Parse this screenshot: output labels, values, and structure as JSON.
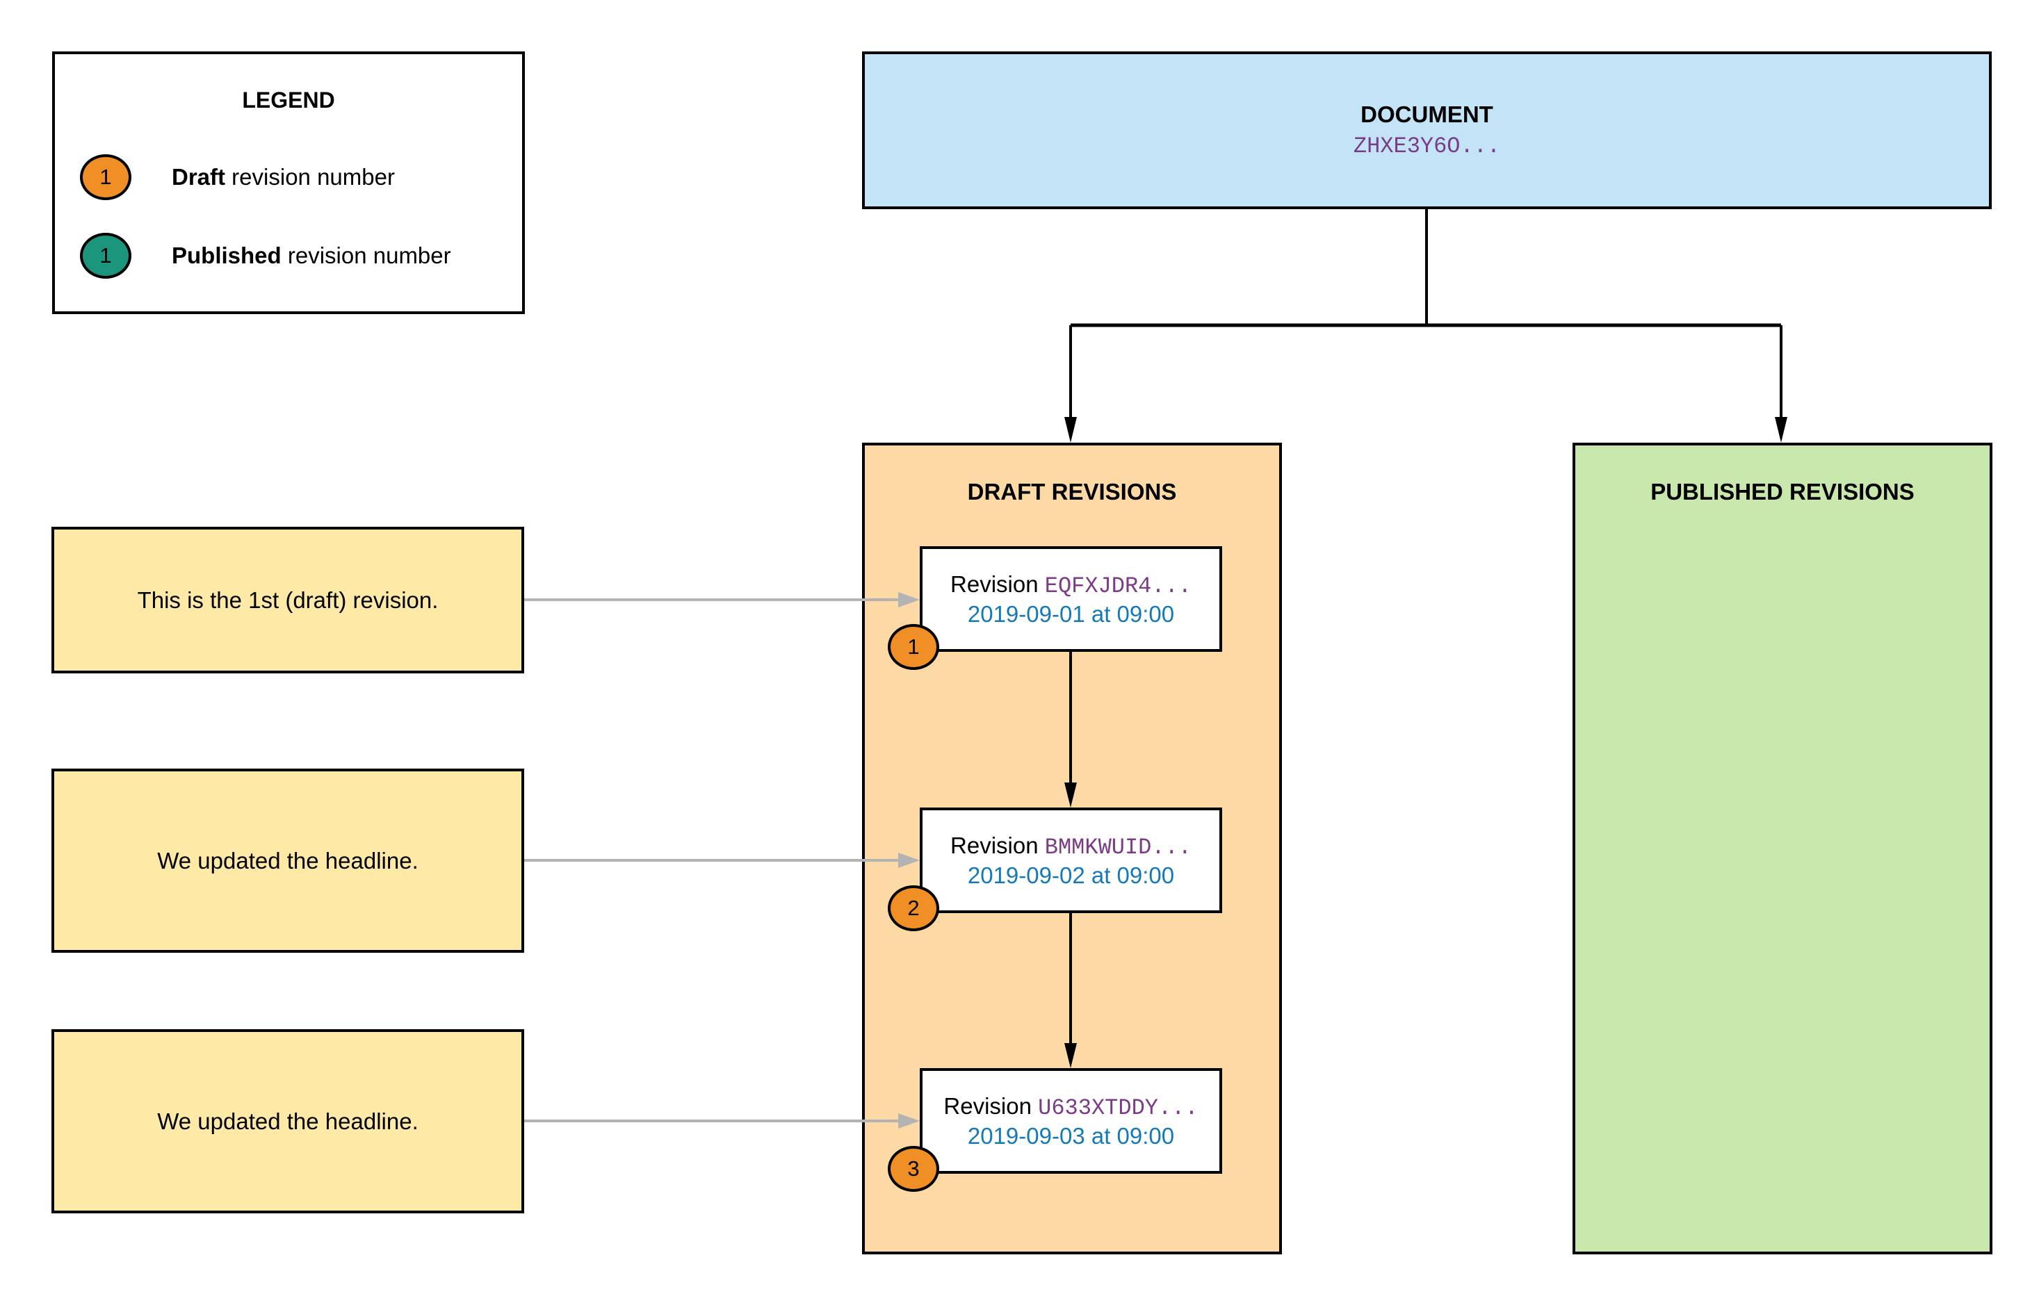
{
  "legend": {
    "title": "LEGEND",
    "items": [
      {
        "badge": "1",
        "bold": "Draft",
        "text": " revision number",
        "color": "#f08f26",
        "icon": "draft-badge"
      },
      {
        "badge": "1",
        "bold": "Published",
        "text": " revision number",
        "color": "#1b967c",
        "icon": "published-badge"
      }
    ]
  },
  "document": {
    "title": "DOCUMENT",
    "id": "ZHXE3Y6O..."
  },
  "containers": {
    "draft": {
      "title": "DRAFT REVISIONS",
      "color": "#fdd9a6"
    },
    "published": {
      "title": "PUBLISHED REVISIONS",
      "color": "#c7e7ac"
    }
  },
  "revisions": [
    {
      "prefix": "Revision ",
      "id": "EQFXJDR4...",
      "date": "2019-09-01 at 09:00",
      "number": "1"
    },
    {
      "prefix": "Revision ",
      "id": "BMMKWUID...",
      "date": "2019-09-02 at 09:00",
      "number": "2"
    },
    {
      "prefix": "Revision ",
      "id": "U633XTDDY...",
      "date": "2019-09-03 at 09:00",
      "number": "3"
    }
  ],
  "notes": [
    {
      "text": "This is the 1st (draft) revision."
    },
    {
      "text": "We updated the headline."
    },
    {
      "text": "We updated the headline."
    }
  ],
  "colors": {
    "document_fill": "#c2e4f6",
    "note_fill": "#feeaa6",
    "draft_badge": "#f08f26",
    "published_badge": "#1b967c",
    "id_text": "#7c3b87",
    "date_text": "#1479b8",
    "note_arrow": "#b3b3b3"
  }
}
